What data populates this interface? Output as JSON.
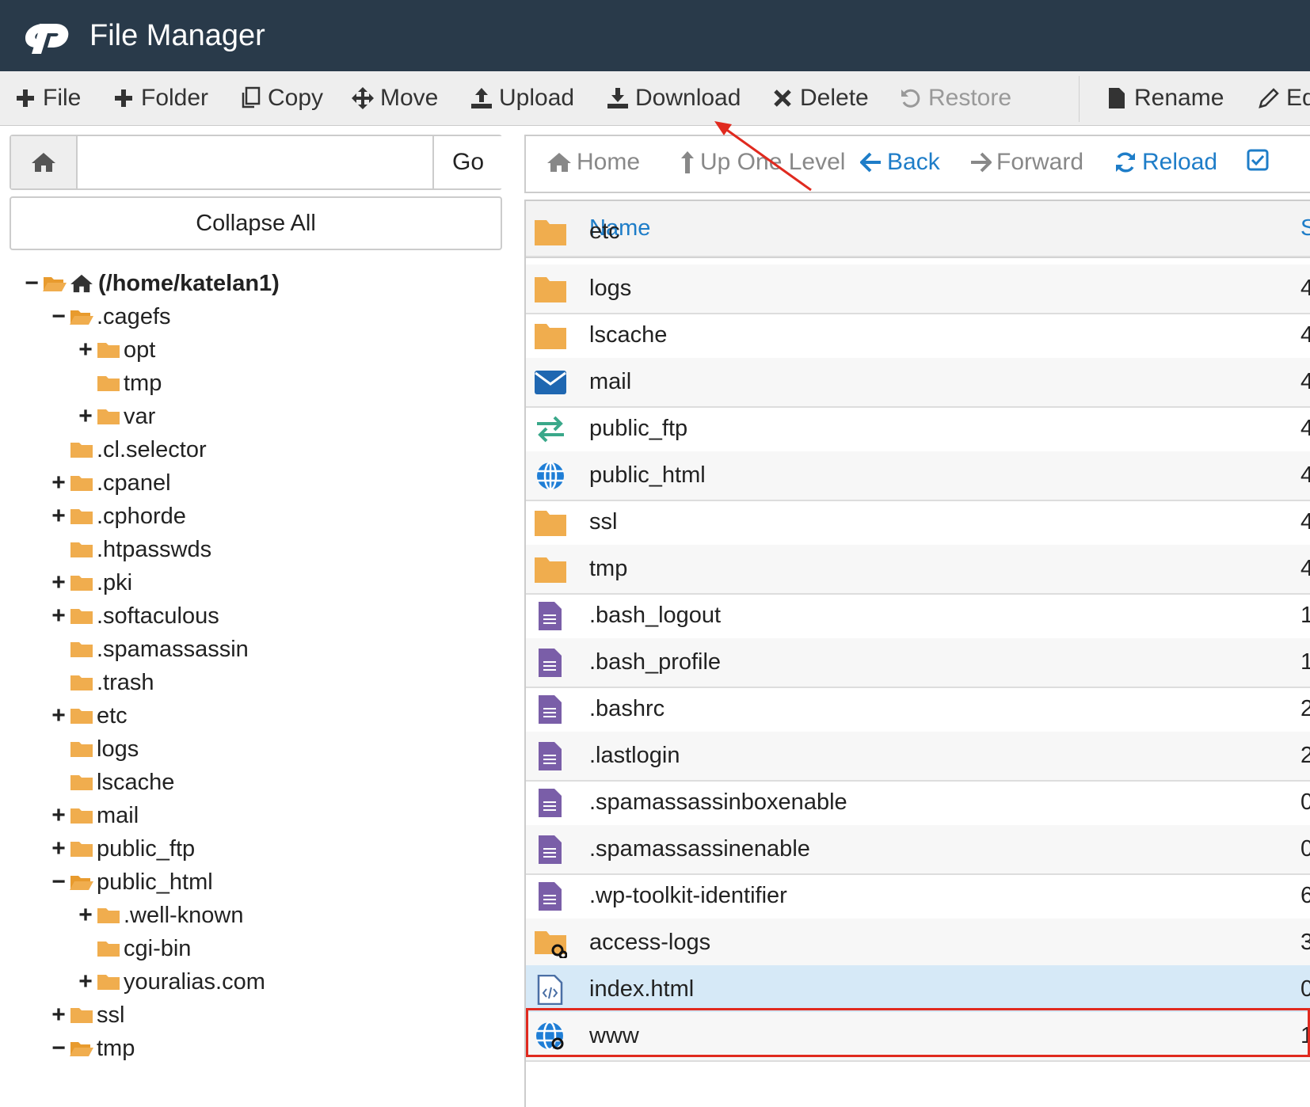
{
  "app": {
    "title": "File Manager",
    "logo": "cp"
  },
  "toolbar": {
    "file": "File",
    "folder": "Folder",
    "copy": "Copy",
    "move": "Move",
    "upload": "Upload",
    "download": "Download",
    "delete": "Delete",
    "restore": "Restore",
    "rename": "Rename",
    "edit": "Ed"
  },
  "path": {
    "value": "",
    "go": "Go"
  },
  "collapse_all": "Collapse All",
  "tree": {
    "root": "(/home/katelan1)",
    "items": [
      ".cagefs",
      "opt",
      "tmp",
      "var",
      ".cl.selector",
      ".cpanel",
      ".cphorde",
      ".htpasswds",
      ".pki",
      ".softaculous",
      ".spamassassin",
      ".trash",
      "etc",
      "logs",
      "lscache",
      "mail",
      "public_ftp",
      "public_html",
      ".well-known",
      "cgi-bin",
      "youralias.com",
      "ssl",
      "tmp"
    ],
    "toggles": {
      "minus": "−",
      "plus": "+"
    }
  },
  "nav": {
    "home": "Home",
    "up": "Up One Level",
    "back": "Back",
    "forward": "Forward",
    "reload": "Reload"
  },
  "table": {
    "col_name": "Name",
    "col_size": "S",
    "rows": [
      {
        "name": "etc",
        "size": "",
        "icon": "folder"
      },
      {
        "name": "logs",
        "size": "4",
        "icon": "folder"
      },
      {
        "name": "lscache",
        "size": "4",
        "icon": "folder"
      },
      {
        "name": "mail",
        "size": "4",
        "icon": "mail"
      },
      {
        "name": "public_ftp",
        "size": "4",
        "icon": "transfer"
      },
      {
        "name": "public_html",
        "size": "4",
        "icon": "globe"
      },
      {
        "name": "ssl",
        "size": "4",
        "icon": "folder"
      },
      {
        "name": "tmp",
        "size": "4",
        "icon": "folder"
      },
      {
        "name": ".bash_logout",
        "size": "1",
        "icon": "file-text"
      },
      {
        "name": ".bash_profile",
        "size": "1",
        "icon": "file-text"
      },
      {
        "name": ".bashrc",
        "size": "2",
        "icon": "file-text"
      },
      {
        "name": ".lastlogin",
        "size": "2",
        "icon": "file-text"
      },
      {
        "name": ".spamassassinboxenable",
        "size": "0",
        "icon": "file-text"
      },
      {
        "name": ".spamassassinenable",
        "size": "0",
        "icon": "file-text"
      },
      {
        "name": ".wp-toolkit-identifier",
        "size": "6",
        "icon": "file-text"
      },
      {
        "name": "access-logs",
        "size": "3",
        "icon": "folder-link"
      },
      {
        "name": "index.html",
        "size": "0",
        "icon": "file-code"
      },
      {
        "name": "www",
        "size": "1",
        "icon": "globe-link"
      }
    ]
  },
  "colors": {
    "topbar": "#293a4a",
    "folder": "#f0ad4e",
    "link": "#1e7dc8",
    "highlight": "#e02a1f",
    "selected_row": "#d6e9f7"
  }
}
